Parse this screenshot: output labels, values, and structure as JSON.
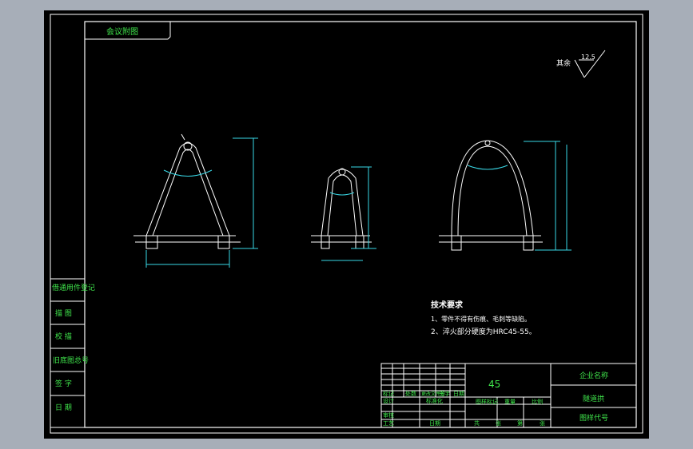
{
  "title_block": {
    "top_left_label": "会议附图",
    "left_column": [
      "借通用件登记",
      "描 图",
      "校 描",
      "旧底图总号",
      "签 字",
      "日 期"
    ],
    "material": "45",
    "company_label": "企业名称",
    "part_name": "隧道拱",
    "drawing_no_label": "图样代号",
    "rev_header": [
      "标记",
      "处数",
      "更改文件号",
      "签字",
      "日期"
    ],
    "design_row": [
      "设计",
      "标准化"
    ],
    "check_row": [
      "审核"
    ],
    "process_row": [
      "工艺",
      "日期"
    ],
    "stage_header": [
      "图样标记",
      "重量",
      "比例"
    ],
    "sheet_row": [
      "共",
      "张",
      "第",
      "张"
    ]
  },
  "notes": {
    "heading": "技术要求",
    "line1": "1、零件不得有伤痕、毛刺等缺陷。",
    "line2": "2、淬火部分硬度为HRC45-55。"
  },
  "surface_finish": {
    "label": "其余",
    "value": "12.5"
  },
  "colors": {
    "background": "#000000",
    "frame": "#ffffff",
    "text_green": "#3fe44b",
    "dimension_cyan": "#39d8e6"
  }
}
